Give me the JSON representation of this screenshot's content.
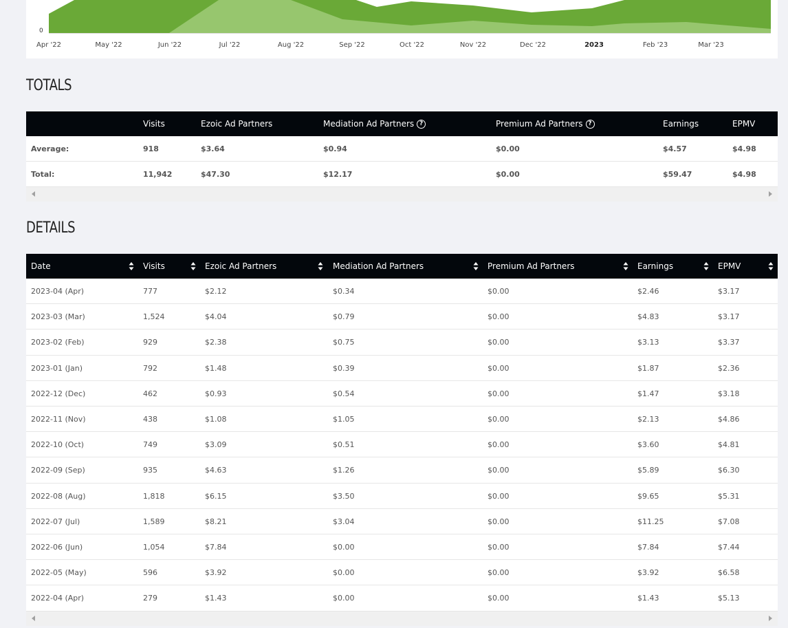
{
  "chart": {
    "y_zero_label": "0",
    "x_ticks": [
      {
        "label": "Apr '22",
        "bold": false
      },
      {
        "label": "May '22",
        "bold": false
      },
      {
        "label": "Jun '22",
        "bold": false
      },
      {
        "label": "Jul '22",
        "bold": false
      },
      {
        "label": "Aug '22",
        "bold": false
      },
      {
        "label": "Sep '22",
        "bold": false
      },
      {
        "label": "Oct '22",
        "bold": false
      },
      {
        "label": "Nov '22",
        "bold": false
      },
      {
        "label": "Dec '22",
        "bold": false
      },
      {
        "label": "2023",
        "bold": true
      },
      {
        "label": "Feb '23",
        "bold": false
      },
      {
        "label": "Mar '23",
        "bold": false
      }
    ],
    "colors": {
      "dark_series": "#6aa937",
      "light_series": "#97c66e",
      "background": "#ffffff"
    }
  },
  "totals": {
    "title": "TOTALS",
    "headers": {
      "label": "",
      "visits": "Visits",
      "ezoic": "Ezoic Ad Partners",
      "mediation": "Mediation Ad Partners",
      "premium": "Premium Ad Partners",
      "earnings": "Earnings",
      "epmv": "EPMV"
    },
    "rows": [
      {
        "label": "Average:",
        "visits": "918",
        "ezoic": "$3.64",
        "mediation": "$0.94",
        "premium": "$0.00",
        "earnings": "$4.57",
        "epmv": "$4.98"
      },
      {
        "label": "Total:",
        "visits": "11,942",
        "ezoic": "$47.30",
        "mediation": "$12.17",
        "premium": "$0.00",
        "earnings": "$59.47",
        "epmv": "$4.98"
      }
    ]
  },
  "details": {
    "title": "DETAILS",
    "headers": {
      "date": "Date",
      "visits": "Visits",
      "ezoic": "Ezoic Ad Partners",
      "mediation": "Mediation Ad Partners",
      "premium": "Premium Ad Partners",
      "earnings": "Earnings",
      "epmv": "EPMV"
    },
    "rows": [
      {
        "date": "2023-04 (Apr)",
        "visits": "777",
        "ezoic": "$2.12",
        "mediation": "$0.34",
        "premium": "$0.00",
        "earnings": "$2.46",
        "epmv": "$3.17"
      },
      {
        "date": "2023-03 (Mar)",
        "visits": "1,524",
        "ezoic": "$4.04",
        "mediation": "$0.79",
        "premium": "$0.00",
        "earnings": "$4.83",
        "epmv": "$3.17"
      },
      {
        "date": "2023-02 (Feb)",
        "visits": "929",
        "ezoic": "$2.38",
        "mediation": "$0.75",
        "premium": "$0.00",
        "earnings": "$3.13",
        "epmv": "$3.37"
      },
      {
        "date": "2023-01 (Jan)",
        "visits": "792",
        "ezoic": "$1.48",
        "mediation": "$0.39",
        "premium": "$0.00",
        "earnings": "$1.87",
        "epmv": "$2.36"
      },
      {
        "date": "2022-12 (Dec)",
        "visits": "462",
        "ezoic": "$0.93",
        "mediation": "$0.54",
        "premium": "$0.00",
        "earnings": "$1.47",
        "epmv": "$3.18"
      },
      {
        "date": "2022-11 (Nov)",
        "visits": "438",
        "ezoic": "$1.08",
        "mediation": "$1.05",
        "premium": "$0.00",
        "earnings": "$2.13",
        "epmv": "$4.86"
      },
      {
        "date": "2022-10 (Oct)",
        "visits": "749",
        "ezoic": "$3.09",
        "mediation": "$0.51",
        "premium": "$0.00",
        "earnings": "$3.60",
        "epmv": "$4.81"
      },
      {
        "date": "2022-09 (Sep)",
        "visits": "935",
        "ezoic": "$4.63",
        "mediation": "$1.26",
        "premium": "$0.00",
        "earnings": "$5.89",
        "epmv": "$6.30"
      },
      {
        "date": "2022-08 (Aug)",
        "visits": "1,818",
        "ezoic": "$6.15",
        "mediation": "$3.50",
        "premium": "$0.00",
        "earnings": "$9.65",
        "epmv": "$5.31"
      },
      {
        "date": "2022-07 (Jul)",
        "visits": "1,589",
        "ezoic": "$8.21",
        "mediation": "$3.04",
        "premium": "$0.00",
        "earnings": "$11.25",
        "epmv": "$7.08"
      },
      {
        "date": "2022-06 (Jun)",
        "visits": "1,054",
        "ezoic": "$7.84",
        "mediation": "$0.00",
        "premium": "$0.00",
        "earnings": "$7.84",
        "epmv": "$7.44"
      },
      {
        "date": "2022-05 (May)",
        "visits": "596",
        "ezoic": "$3.92",
        "mediation": "$0.00",
        "premium": "$0.00",
        "earnings": "$3.92",
        "epmv": "$6.58"
      },
      {
        "date": "2022-04 (Apr)",
        "visits": "279",
        "ezoic": "$1.43",
        "mediation": "$0.00",
        "premium": "$0.00",
        "earnings": "$1.43",
        "epmv": "$5.13"
      }
    ]
  }
}
